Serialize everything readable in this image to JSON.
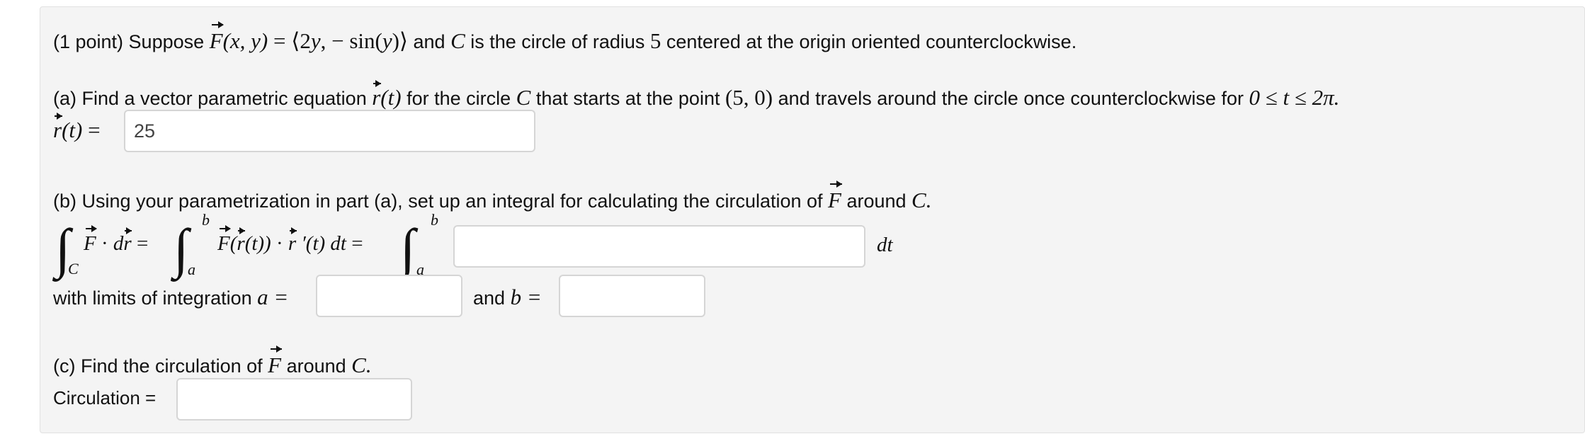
{
  "intro": {
    "lead": "(1 point) Suppose ",
    "field": "F(x, y) = ⟨2y, − sin(y)⟩",
    "mid": " and ",
    "curve": "C",
    "tail": " is the circle of radius ",
    "radius": "5",
    "end": " centered at the origin oriented counterclockwise."
  },
  "part_a": {
    "text_1": "(a) Find a vector parametric equation ",
    "r_t": "r(t)",
    "text_2": " for the circle ",
    "curve": "C",
    "text_3": " that starts at the point ",
    "point": "(5, 0)",
    "text_4": " and travels around the circle once counterclockwise for ",
    "range": "0 ≤ t ≤ 2π.",
    "answer_label": "r(t) =",
    "answer_value": "25"
  },
  "part_b": {
    "text_1": "(b) Using your parametrization in part (a), set up an integral for calculating the circulation of ",
    "F": "F",
    "text_2": " around ",
    "curve": "C.",
    "int_C_sub": "C",
    "integrand_1": "F · dr =",
    "integrand_2": "F(r(t)) · r ′(t) dt =",
    "lim_a": "a",
    "lim_b": "b",
    "dt": "dt",
    "integrand_value": "",
    "limits_label": "with limits of integration ",
    "a_eq": "a =",
    "and_label": "and ",
    "b_eq": "b =",
    "a_value": "",
    "b_value": ""
  },
  "part_c": {
    "text_1": "(c) Find the circulation of ",
    "F": "F",
    "text_2": " around ",
    "curve": "C.",
    "circulation_label": "Circulation =",
    "circulation_value": ""
  }
}
